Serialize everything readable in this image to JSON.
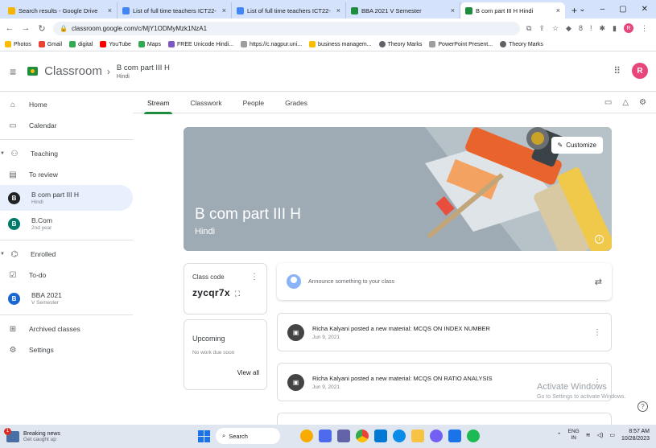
{
  "browser": {
    "tabs": [
      {
        "title": "Search results - Google Drive",
        "color": "#f4b400"
      },
      {
        "title": "List of full time teachers ICT22-",
        "color": "#4285f4"
      },
      {
        "title": "List of full time teachers ICT22-",
        "color": "#4285f4"
      },
      {
        "title": "BBA 2021 V Semester",
        "color": "#1e8e3e"
      },
      {
        "title": "B com part III H Hindi",
        "color": "#1e8e3e",
        "active": true
      }
    ],
    "new_tab": "+",
    "url": "classroom.google.com/c/MjY1ODMyMzk1NzA1",
    "bookmarks": [
      {
        "label": "Photos",
        "color": "#fbbc04"
      },
      {
        "label": "Gmail",
        "color": "#ea4335"
      },
      {
        "label": "digital",
        "color": "#34a853"
      },
      {
        "label": "YouTube",
        "color": "#ff0000"
      },
      {
        "label": "Maps",
        "color": "#34a853"
      },
      {
        "label": "FREE Unicode Hindi...",
        "color": "#7e57c2"
      },
      {
        "label": "https://c.nagpur.uni...",
        "color": "#9e9e9e"
      },
      {
        "label": "business managem...",
        "color": "#fbbc04"
      },
      {
        "label": "Theory Marks",
        "color": "#5f6368"
      },
      {
        "label": "PowerPoint Present...",
        "color": "#9e9e9e"
      },
      {
        "label": "Theory Marks",
        "color": "#5f6368"
      }
    ],
    "profile_initial": "R"
  },
  "header": {
    "brand": "Classroom",
    "class_name": "B com part III H",
    "class_section": "Hindi",
    "avatar_initial": "R"
  },
  "sidebar": {
    "home": "Home",
    "calendar": "Calendar",
    "teaching": "Teaching",
    "to_review": "To review",
    "teaching_classes": [
      {
        "initial": "B",
        "name": "B com part III H",
        "sub": "Hindi",
        "color": "#202124",
        "active": true
      },
      {
        "initial": "B",
        "name": "B.Com",
        "sub": "2nd year",
        "color": "#00796b"
      }
    ],
    "enrolled": "Enrolled",
    "todo": "To-do",
    "enrolled_classes": [
      {
        "initial": "B",
        "name": "BBA 2021",
        "sub": "V Semester",
        "color": "#1967d2"
      }
    ],
    "archived": "Archived classes",
    "settings": "Settings"
  },
  "tabs": [
    "Stream",
    "Classwork",
    "People",
    "Grades"
  ],
  "banner": {
    "title": "B com part III H",
    "subtitle": "Hindi",
    "customize": "Customize"
  },
  "class_code": {
    "label": "Class code",
    "value": "zycqr7x"
  },
  "upcoming": {
    "title": "Upcoming",
    "empty": "No work due soon",
    "view_all": "View all"
  },
  "announce": {
    "placeholder": "Announce something to your class"
  },
  "posts": [
    {
      "title": "Richa Kalyani posted a new material: MCQS ON INDEX NUMBER",
      "date": "Jun 9, 2021"
    },
    {
      "title": "Richa Kalyani posted a new material: MCQS ON RATIO ANALYSIS",
      "date": "Jun 9, 2021"
    }
  ],
  "watermark": {
    "line1": "Activate Windows",
    "line2": "Go to Settings to activate Windows."
  },
  "taskbar": {
    "news_title": "Breaking news",
    "news_sub": "Get caught up",
    "news_badge": "1",
    "search": "Search",
    "lang_top": "ENG",
    "lang_bottom": "IN",
    "time": "8:57 AM",
    "date": "10/28/2023",
    "apps": [
      {
        "name": "people-app",
        "color": "#f9ab00"
      },
      {
        "name": "files-app",
        "color": "#4f6bed"
      },
      {
        "name": "teams-app",
        "color": "#6264a7"
      },
      {
        "name": "chrome-app",
        "color": "#ea4335"
      },
      {
        "name": "store-app",
        "color": "#0078d4"
      },
      {
        "name": "edge-app",
        "color": "#0c8ce9"
      },
      {
        "name": "explorer-app",
        "color": "#f6c344"
      },
      {
        "name": "viber-app",
        "color": "#7360f2"
      },
      {
        "name": "mail-app",
        "color": "#1a73e8"
      },
      {
        "name": "spotify-app",
        "color": "#1db954"
      }
    ]
  }
}
